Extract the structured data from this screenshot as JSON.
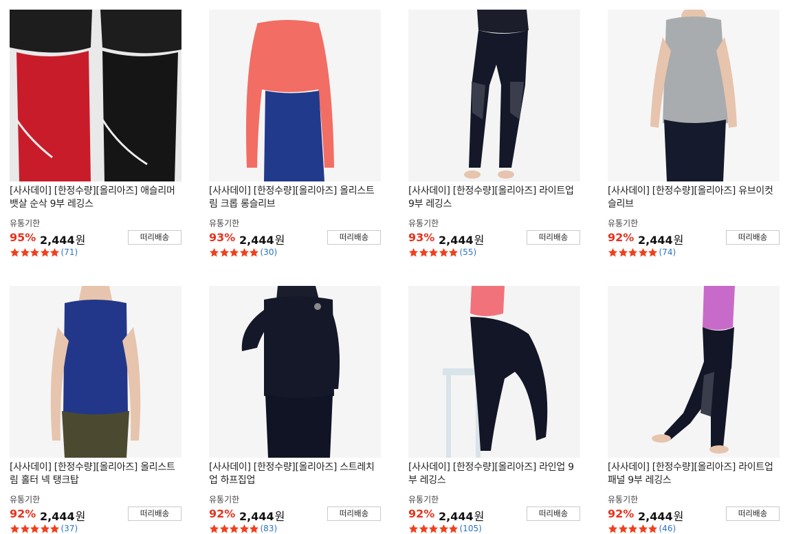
{
  "colors": {
    "discount": "#e7321f",
    "star": "#f0401c",
    "count": "#2a72c6"
  },
  "products": [
    {
      "title": "[사사데이] [한정수량][올리아즈] 애슬리머 뱃살 순삭 9부 레깅스",
      "expiry": "유통기한",
      "discount": "95%",
      "price": "2,444",
      "currency": "원",
      "shipping": "떠리배송",
      "stars": 5,
      "reviews": "(71)",
      "image": "red-and-black-leggings"
    },
    {
      "title": "[사사데이] [한정수량][올리아즈] 올리스트림 크롭 롱슬리브",
      "expiry": "유통기한",
      "discount": "93%",
      "price": "2,444",
      "currency": "원",
      "shipping": "떠리배송",
      "stars": 5,
      "reviews": "(30)",
      "image": "coral-crop-long-sleeve"
    },
    {
      "title": "[사사데이] [한정수량][올리아즈] 라이트업 9부 레깅스",
      "expiry": "유통기한",
      "discount": "93%",
      "price": "2,444",
      "currency": "원",
      "shipping": "떠리배송",
      "stars": 5,
      "reviews": "(55)",
      "image": "navy-leggings-mesh"
    },
    {
      "title": "[사사데이] [한정수량][올리아즈] 유브이컷 슬리브",
      "expiry": "유통기한",
      "discount": "92%",
      "price": "2,444",
      "currency": "원",
      "shipping": "떠리배송",
      "stars": 5,
      "reviews": "(74)",
      "image": "gray-sleeveless-top"
    },
    {
      "title": "[사사데이] [한정수량][올리아즈] 올리스트림 홀터 넥 탱크탑",
      "expiry": "유통기한",
      "discount": "92%",
      "price": "2,444",
      "currency": "원",
      "shipping": "떠리배송",
      "stars": 5,
      "reviews": "(37)",
      "image": "blue-halter-tank"
    },
    {
      "title": "[사사데이] [한정수량][올리아즈] 스트레치 업 하프집업",
      "expiry": "유통기한",
      "discount": "92%",
      "price": "2,444",
      "currency": "원",
      "shipping": "떠리배송",
      "stars": 5,
      "reviews": "(83)",
      "image": "navy-half-zip"
    },
    {
      "title": "[사사데이] [한정수량][올리아즈] 라인업 9부 레깅스",
      "expiry": "유통기한",
      "discount": "92%",
      "price": "2,444",
      "currency": "원",
      "shipping": "떠리배송",
      "stars": 5,
      "reviews": "(105)",
      "image": "navy-leggings-stool"
    },
    {
      "title": "[사사데이] [한정수량][올리아즈] 라이트업 패널 9부 레깅스",
      "expiry": "유통기한",
      "discount": "92%",
      "price": "2,444",
      "currency": "원",
      "shipping": "떠리배송",
      "stars": 5,
      "reviews": "(46)",
      "image": "navy-panel-leggings"
    }
  ]
}
